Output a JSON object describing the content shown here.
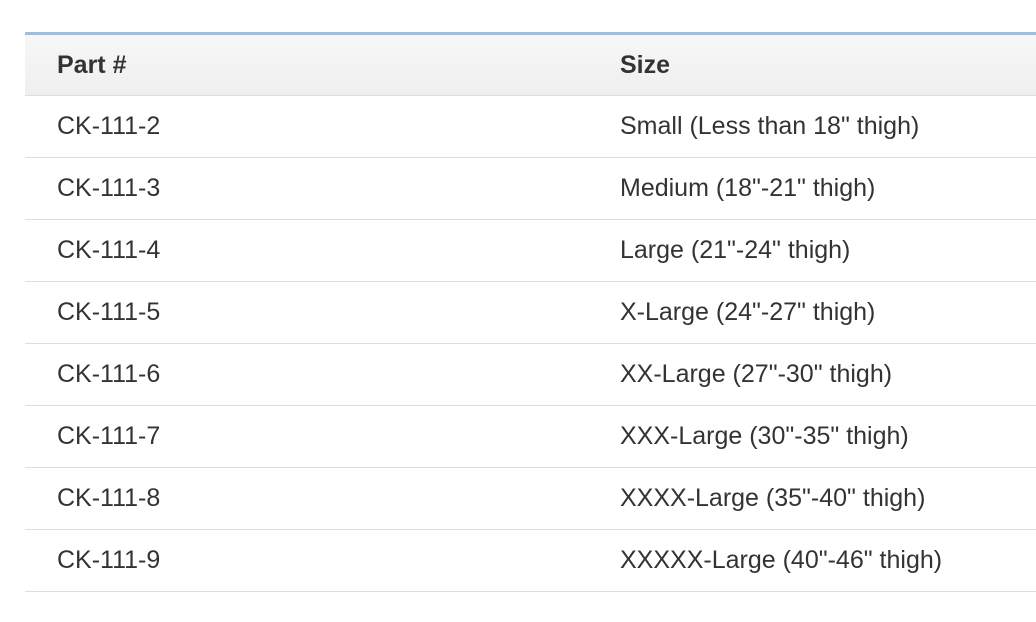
{
  "table": {
    "headers": {
      "part": "Part #",
      "size": "Size"
    },
    "rows": [
      {
        "part": "CK-111-2",
        "size": "Small (Less than 18\" thigh)"
      },
      {
        "part": "CK-111-3",
        "size": "Medium (18\"-21\" thigh)"
      },
      {
        "part": "CK-111-4",
        "size": "Large (21\"-24\" thigh)"
      },
      {
        "part": "CK-111-5",
        "size": "X-Large (24\"-27\" thigh)"
      },
      {
        "part": "CK-111-6",
        "size": "XX-Large (27\"-30\" thigh)"
      },
      {
        "part": "CK-111-7",
        "size": "XXX-Large (30\"-35\" thigh)"
      },
      {
        "part": "CK-111-8",
        "size": "XXXX-Large (35\"-40\" thigh)"
      },
      {
        "part": "CK-111-9",
        "size": "XXXXX-Large (40\"-46\" thigh)"
      }
    ]
  },
  "colors": {
    "top_border": "#9cbfe0",
    "row_divider": "#dddddd",
    "text": "#333333"
  }
}
